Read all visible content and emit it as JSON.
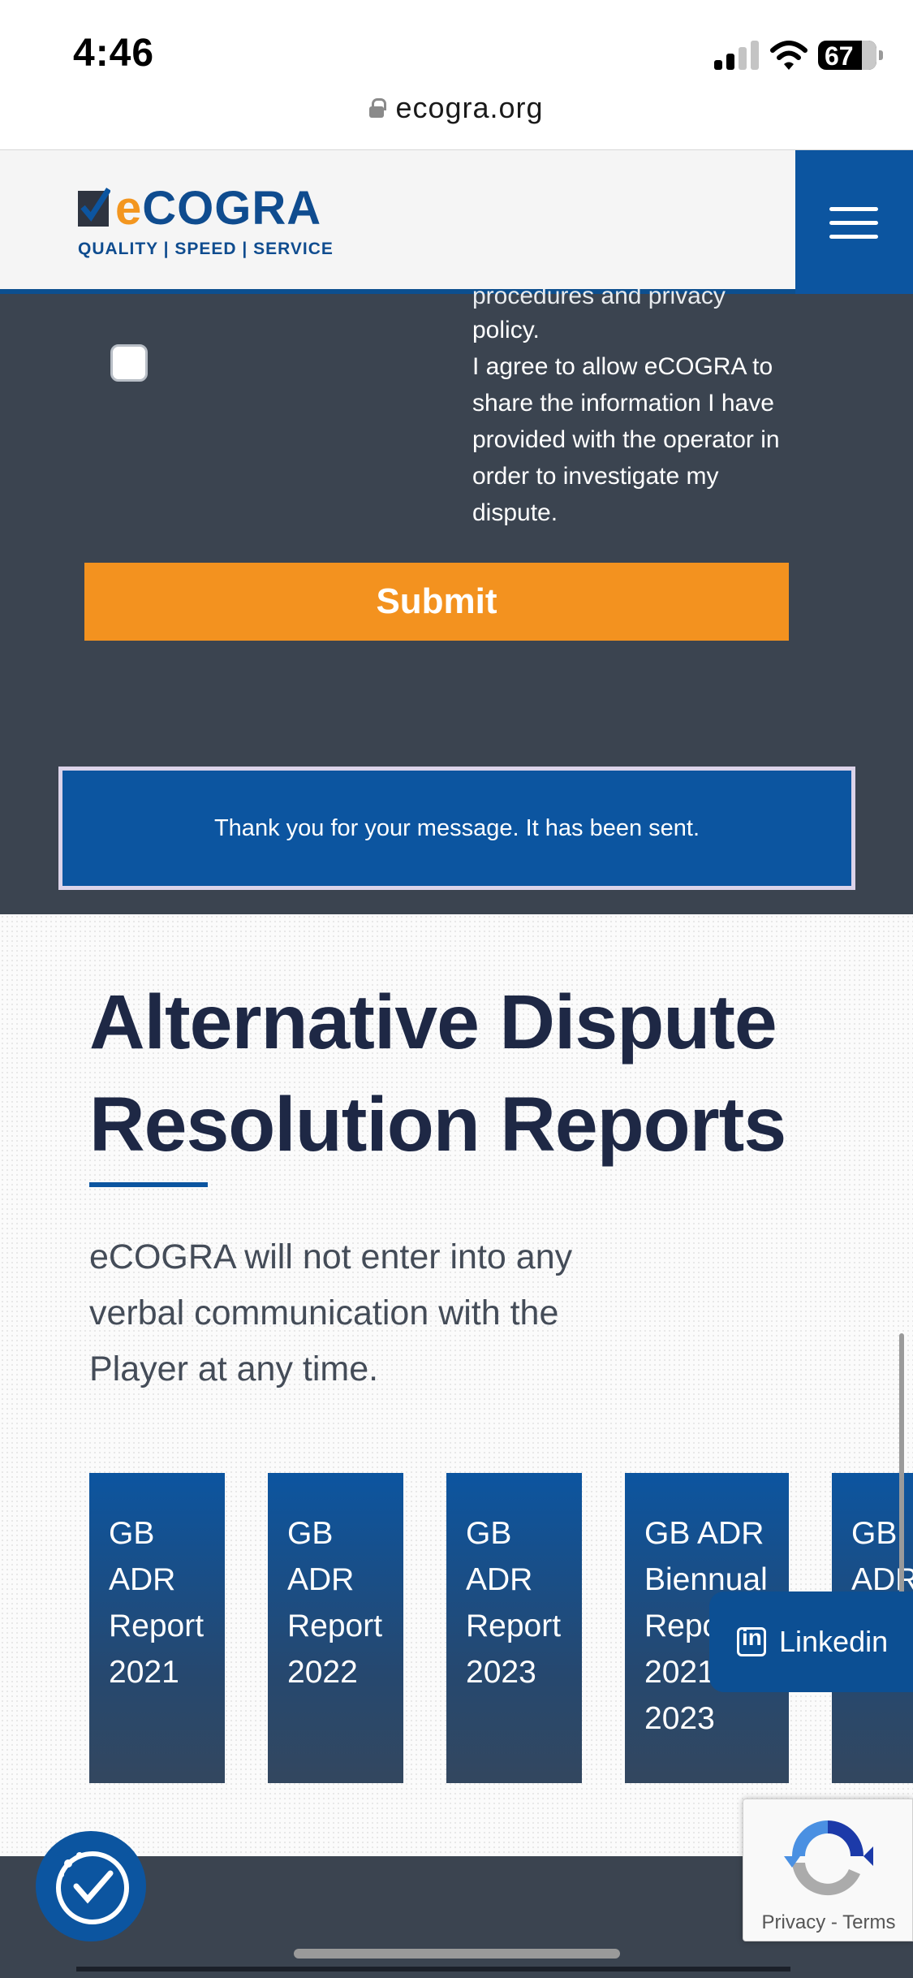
{
  "status_bar": {
    "time": "4:46",
    "battery": "67"
  },
  "browser": {
    "url": "ecogra.org"
  },
  "header": {
    "logo_e": "e",
    "logo_cogra": "COGRA",
    "logo_tagline": "QUALITY | SPEED | SERVICE",
    "brand_colors": {
      "blue": "#0c55a0",
      "orange": "#f3921f"
    }
  },
  "form": {
    "consent_partial": "procedures and privacy",
    "consent_policy": "policy.",
    "consent_text": "I agree to allow eCOGRA to share the information I have provided with the operator in order to investigate my dispute.",
    "submit_label": "Submit",
    "thankyou_message": "Thank you for your message. It has been sent."
  },
  "reports": {
    "heading": "Alternative Dispute Resolution Reports",
    "intro": "eCOGRA will not enter into any verbal communication with the Player at any time.",
    "cards": [
      {
        "label": "GB ADR Report 2021"
      },
      {
        "label": "GB ADR Report 2022"
      },
      {
        "label": "GB ADR Report 2023"
      },
      {
        "label": "GB ADR Biennual Report 2021 - 2023"
      },
      {
        "label": "GB ADR"
      }
    ]
  },
  "social": {
    "linkedin_label": "Linkedin"
  },
  "recaptcha": {
    "privacy": "Privacy",
    "separator": "-",
    "terms": "Terms"
  }
}
